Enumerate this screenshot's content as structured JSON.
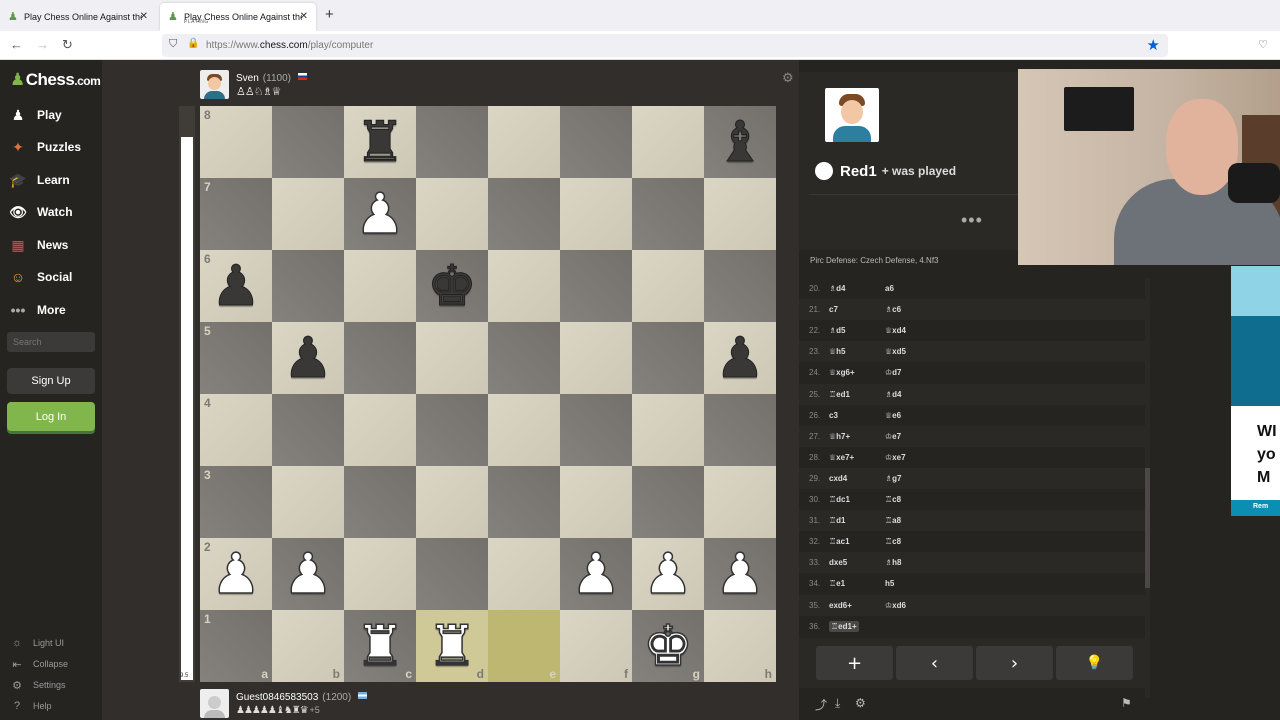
{
  "browser": {
    "tabs": [
      {
        "title": "Play Chess Online Against the C"
      },
      {
        "title": "Play Chess Online Against the C",
        "subtitle": "PLAYING"
      }
    ],
    "new_tab": "+",
    "url_prefix": "https://www.",
    "url_domain": "chess.com",
    "url_path": "/play/computer"
  },
  "sidebar": {
    "logo": "Chess",
    "logo_suffix": ".com",
    "items": [
      {
        "label": "Play"
      },
      {
        "label": "Puzzles"
      },
      {
        "label": "Learn"
      },
      {
        "label": "Watch"
      },
      {
        "label": "News"
      },
      {
        "label": "Social"
      },
      {
        "label": "More"
      }
    ],
    "search_placeholder": "Search",
    "signup": "Sign Up",
    "login": "Log In",
    "footer": [
      {
        "label": "Light UI"
      },
      {
        "label": "Collapse"
      },
      {
        "label": "Settings"
      },
      {
        "label": "Help"
      }
    ]
  },
  "top_player": {
    "name": "Sven",
    "rating": "(1100)",
    "captured": "♙♙♘♗♕"
  },
  "bottom_player": {
    "name": "Guest0846583503",
    "rating": "(1200)",
    "captured": "♟♟♟♟♟♝♞♜♛",
    "advantage": "+5"
  },
  "eval": {
    "value": "9.5",
    "white_fraction": 0.95
  },
  "board": {
    "ranks": [
      "8",
      "7",
      "6",
      "5",
      "4",
      "3",
      "2",
      "1"
    ],
    "files": [
      "a",
      "b",
      "c",
      "d",
      "e",
      "f",
      "g",
      "h"
    ],
    "pieces": [
      {
        "sq": "c8",
        "glyph": "♜",
        "color": "b"
      },
      {
        "sq": "h8",
        "glyph": "♝",
        "color": "b"
      },
      {
        "sq": "c7",
        "glyph": "♟",
        "color": "w"
      },
      {
        "sq": "a6",
        "glyph": "♟",
        "color": "b"
      },
      {
        "sq": "d6",
        "glyph": "♚",
        "color": "b"
      },
      {
        "sq": "b5",
        "glyph": "♟",
        "color": "b"
      },
      {
        "sq": "h5",
        "glyph": "♟",
        "color": "b"
      },
      {
        "sq": "a2",
        "glyph": "♟",
        "color": "w"
      },
      {
        "sq": "b2",
        "glyph": "♟",
        "color": "w"
      },
      {
        "sq": "f2",
        "glyph": "♟",
        "color": "w"
      },
      {
        "sq": "g2",
        "glyph": "♟",
        "color": "w"
      },
      {
        "sq": "h2",
        "glyph": "♟",
        "color": "w"
      },
      {
        "sq": "c1",
        "glyph": "♜",
        "color": "w"
      },
      {
        "sq": "d1",
        "glyph": "♜",
        "color": "w"
      },
      {
        "sq": "g1",
        "glyph": "♚",
        "color": "w"
      }
    ],
    "highlight": [
      "d1",
      "e1"
    ]
  },
  "panel": {
    "move_played": "Red1",
    "move_suffix": "+ was played",
    "more": "•••",
    "opening": "Pirc Defense: Czech Defense, 4.Nf3",
    "moves": [
      {
        "n": "20.",
        "w": "♗d4",
        "b": "a6"
      },
      {
        "n": "21.",
        "w": "c7",
        "b": "♗c6"
      },
      {
        "n": "22.",
        "w": "♗d5",
        "b": "♕xd4"
      },
      {
        "n": "23.",
        "w": "♕h5",
        "b": "♕xd5"
      },
      {
        "n": "24.",
        "w": "♕xg6+",
        "b": "♔d7"
      },
      {
        "n": "25.",
        "w": "♖ed1",
        "b": "♗d4"
      },
      {
        "n": "26.",
        "w": "c3",
        "b": "♕e6"
      },
      {
        "n": "27.",
        "w": "♕h7+",
        "b": "♔e7"
      },
      {
        "n": "28.",
        "w": "♕xe7+",
        "b": "♔xe7"
      },
      {
        "n": "29.",
        "w": "cxd4",
        "b": "♗g7"
      },
      {
        "n": "30.",
        "w": "♖dc1",
        "b": "♖c8"
      },
      {
        "n": "31.",
        "w": "♖d1",
        "b": "♖a8"
      },
      {
        "n": "32.",
        "w": "♖ac1",
        "b": "♖c8"
      },
      {
        "n": "33.",
        "w": "dxe5",
        "b": "♗h8"
      },
      {
        "n": "34.",
        "w": "♖e1",
        "b": "h5"
      },
      {
        "n": "35.",
        "w": "exd6+",
        "b": "♔xd6"
      },
      {
        "n": "36.",
        "w": "♖ed1+",
        "b": ""
      }
    ],
    "controls": [
      "+",
      "‹",
      "›",
      "💡"
    ]
  },
  "ad": {
    "text": "WI\nyo\nM",
    "footer": "Rem"
  },
  "colors": {
    "accent": "#81b64c",
    "dark_bg": "#262421",
    "board_light": "#d8d2bf",
    "board_dark": "#7d7a75"
  }
}
